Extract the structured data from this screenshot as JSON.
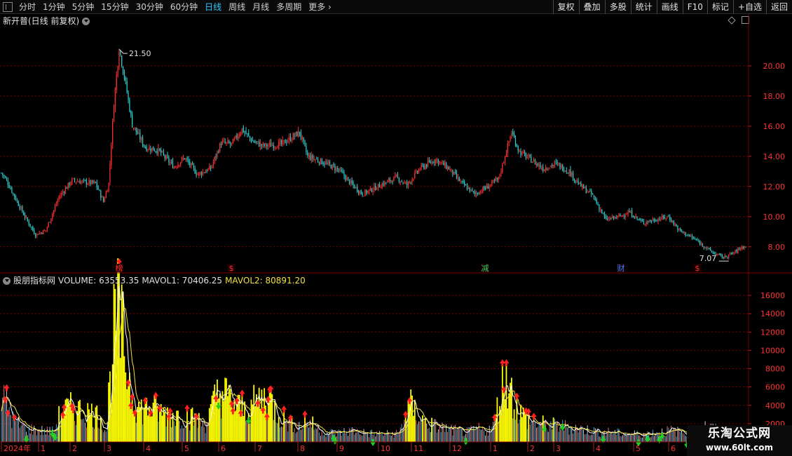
{
  "toolbar": {
    "periods": [
      "分时",
      "1分钟",
      "5分钟",
      "15分钟",
      "30分钟",
      "60分钟",
      "日线",
      "周线",
      "月线",
      "多周期",
      "更多"
    ],
    "active": "日线",
    "buttons": [
      "复权",
      "叠加",
      "多股",
      "统计",
      "画线",
      "F10",
      "标记",
      "+自选",
      "返回"
    ]
  },
  "chart_title": "新开普(日线 前复权)",
  "price_axis": [
    "20.00",
    "18.00",
    "16.00",
    "14.00",
    "12.00",
    "10.00",
    "8.00"
  ],
  "price_range": [
    6.5,
    22.6
  ],
  "annotations": {
    "high": "21.50",
    "low": "7.07"
  },
  "event_markers": [
    {
      "label": "榜",
      "type": "red"
    },
    {
      "label": "$",
      "type": "red"
    },
    {
      "label": "减",
      "type": "green"
    },
    {
      "label": "财",
      "type": "blue"
    },
    {
      "label": "$",
      "type": "red"
    }
  ],
  "indicator": {
    "name": "股朋指标网",
    "volume": "VOLUME: 63553.35",
    "mavol1": "MAVOL1: 70406.25",
    "mavol2": "MAVOL2: 80891.20"
  },
  "volume_axis": [
    "16000",
    "14000",
    "12000",
    "10000",
    "8000",
    "6000",
    "4000",
    "2000"
  ],
  "volume_range": [
    0,
    17000
  ],
  "x_axis": [
    "2024年",
    "1",
    "2",
    "3",
    "4",
    "5",
    "6",
    "7",
    "8",
    "9",
    "10",
    "11",
    "12",
    "1",
    "2",
    "3",
    "4",
    "5",
    "6"
  ],
  "watermark": {
    "title": "乐淘公式网",
    "url": "www.60lt.com"
  },
  "colors": {
    "up": "#ff3030",
    "down": "#30d0d0",
    "grid": "#7a0000",
    "axis_text": "#ff3333",
    "vol_highlight": "#ffff00",
    "ma1": "#ffffff",
    "ma2": "#f0e040"
  },
  "chart_data": [
    {
      "type": "candlestick",
      "title": "新开普(日线 前复权)",
      "ylim": [
        6.5,
        22.6
      ],
      "anchors": [
        [
          0,
          12.9
        ],
        [
          4,
          12.4
        ],
        [
          12,
          11.0
        ],
        [
          18,
          10.0
        ],
        [
          26,
          8.8
        ],
        [
          34,
          9.1
        ],
        [
          44,
          11.3
        ],
        [
          54,
          12.4
        ],
        [
          72,
          12.2
        ],
        [
          78,
          11.0
        ],
        [
          82,
          12.2
        ],
        [
          86,
          17.5
        ],
        [
          90,
          21.2
        ],
        [
          95,
          18.8
        ],
        [
          100,
          16.1
        ],
        [
          110,
          14.6
        ],
        [
          120,
          14.4
        ],
        [
          132,
          13.3
        ],
        [
          140,
          13.9
        ],
        [
          150,
          12.8
        ],
        [
          160,
          13.2
        ],
        [
          168,
          14.9
        ],
        [
          176,
          14.8
        ],
        [
          184,
          15.8
        ],
        [
          192,
          15.0
        ],
        [
          200,
          14.7
        ],
        [
          214,
          14.8
        ],
        [
          228,
          15.6
        ],
        [
          234,
          14.0
        ],
        [
          246,
          13.6
        ],
        [
          258,
          13.1
        ],
        [
          266,
          12.3
        ],
        [
          276,
          11.5
        ],
        [
          290,
          12.1
        ],
        [
          302,
          12.6
        ],
        [
          310,
          12.1
        ],
        [
          320,
          13.2
        ],
        [
          332,
          13.8
        ],
        [
          342,
          13.2
        ],
        [
          352,
          12.2
        ],
        [
          362,
          11.5
        ],
        [
          372,
          12.0
        ],
        [
          380,
          12.5
        ],
        [
          390,
          15.6
        ],
        [
          396,
          14.3
        ],
        [
          406,
          13.7
        ],
        [
          414,
          13.2
        ],
        [
          424,
          13.5
        ],
        [
          434,
          13.0
        ],
        [
          442,
          12.1
        ],
        [
          452,
          11.4
        ],
        [
          462,
          9.8
        ],
        [
          472,
          10.0
        ],
        [
          480,
          10.3
        ],
        [
          490,
          9.6
        ],
        [
          500,
          9.8
        ],
        [
          510,
          10.0
        ],
        [
          518,
          9.1
        ],
        [
          530,
          8.5
        ],
        [
          538,
          8.0
        ],
        [
          544,
          7.6
        ],
        [
          552,
          7.3
        ],
        [
          560,
          7.6
        ],
        [
          566,
          8.0
        ]
      ],
      "high_label": "21.50",
      "low_label": "7.07"
    },
    {
      "type": "bar",
      "title": "股朋指标网",
      "ylim": [
        0,
        17000
      ],
      "anchors": [
        [
          0,
          5000
        ],
        [
          4,
          4200
        ],
        [
          10,
          2200
        ],
        [
          20,
          1500
        ],
        [
          30,
          1300
        ],
        [
          40,
          1200
        ],
        [
          46,
          3600
        ],
        [
          54,
          3800
        ],
        [
          70,
          3200
        ],
        [
          76,
          2800
        ],
        [
          80,
          1200
        ],
        [
          84,
          9000
        ],
        [
          88,
          15000
        ],
        [
          92,
          12500
        ],
        [
          96,
          8500
        ],
        [
          100,
          5500
        ],
        [
          106,
          3700
        ],
        [
          114,
          3900
        ],
        [
          122,
          3300
        ],
        [
          130,
          3100
        ],
        [
          138,
          3000
        ],
        [
          146,
          2700
        ],
        [
          152,
          2300
        ],
        [
          156,
          2000
        ],
        [
          160,
          3500
        ],
        [
          166,
          5800
        ],
        [
          172,
          5200
        ],
        [
          180,
          4000
        ],
        [
          186,
          3700
        ],
        [
          192,
          4200
        ],
        [
          198,
          4800
        ],
        [
          204,
          5200
        ],
        [
          210,
          3600
        ],
        [
          216,
          2500
        ],
        [
          222,
          2000
        ],
        [
          228,
          1900
        ],
        [
          234,
          2500
        ],
        [
          240,
          1700
        ],
        [
          246,
          1200
        ],
        [
          256,
          1000
        ],
        [
          268,
          1300
        ],
        [
          280,
          1000
        ],
        [
          294,
          900
        ],
        [
          304,
          1000
        ],
        [
          312,
          4200
        ],
        [
          318,
          3200
        ],
        [
          324,
          2200
        ],
        [
          332,
          1800
        ],
        [
          340,
          1500
        ],
        [
          348,
          1300
        ],
        [
          356,
          1100
        ],
        [
          364,
          1500
        ],
        [
          370,
          1300
        ],
        [
          376,
          1700
        ],
        [
          382,
          5800
        ],
        [
          386,
          8000
        ],
        [
          390,
          5500
        ],
        [
          396,
          3300
        ],
        [
          406,
          2200
        ],
        [
          420,
          1900
        ],
        [
          436,
          1700
        ],
        [
          450,
          1300
        ],
        [
          466,
          1100
        ],
        [
          480,
          900
        ],
        [
          496,
          1000
        ],
        [
          510,
          1300
        ],
        [
          524,
          1100
        ],
        [
          538,
          1800
        ],
        [
          550,
          1200
        ],
        [
          566,
          1300
        ]
      ]
    }
  ]
}
